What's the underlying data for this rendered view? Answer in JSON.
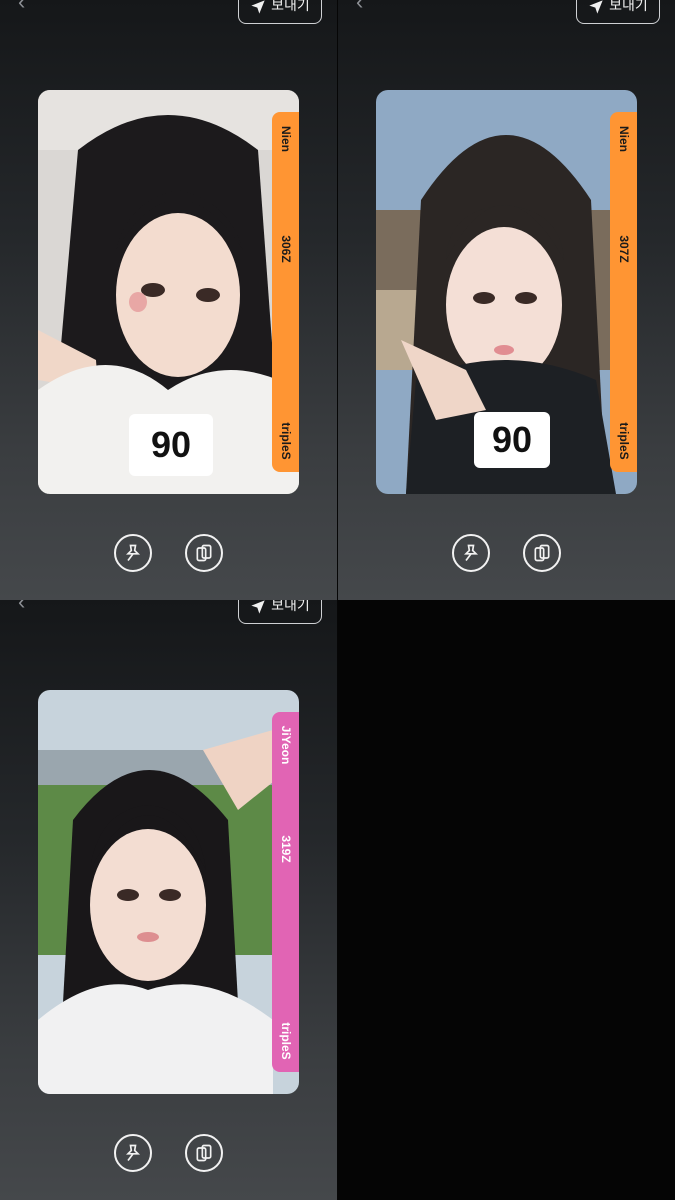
{
  "panels": [
    {
      "send_label": "보내기",
      "card": {
        "member": "Nien",
        "serial": "306Z",
        "group": "tripleS",
        "score": "90",
        "band_color": "#ff9533"
      }
    },
    {
      "send_label": "보내기",
      "card": {
        "member": "Nien",
        "serial": "307Z",
        "group": "tripleS",
        "score": "90",
        "band_color": "#ff9533"
      }
    },
    {
      "send_label": "보내기",
      "card": {
        "member": "JiYeon",
        "serial": "319Z",
        "group": "tripleS",
        "score": "",
        "band_color": "#e164b4"
      }
    }
  ],
  "icons": {
    "back": "chevron-left-icon",
    "send": "paper-plane-icon",
    "pin": "pin-icon",
    "copy": "copy-icon"
  },
  "colors": {
    "background": "#060606",
    "orange_band": "#ff9533",
    "pink_band": "#e164b4"
  }
}
